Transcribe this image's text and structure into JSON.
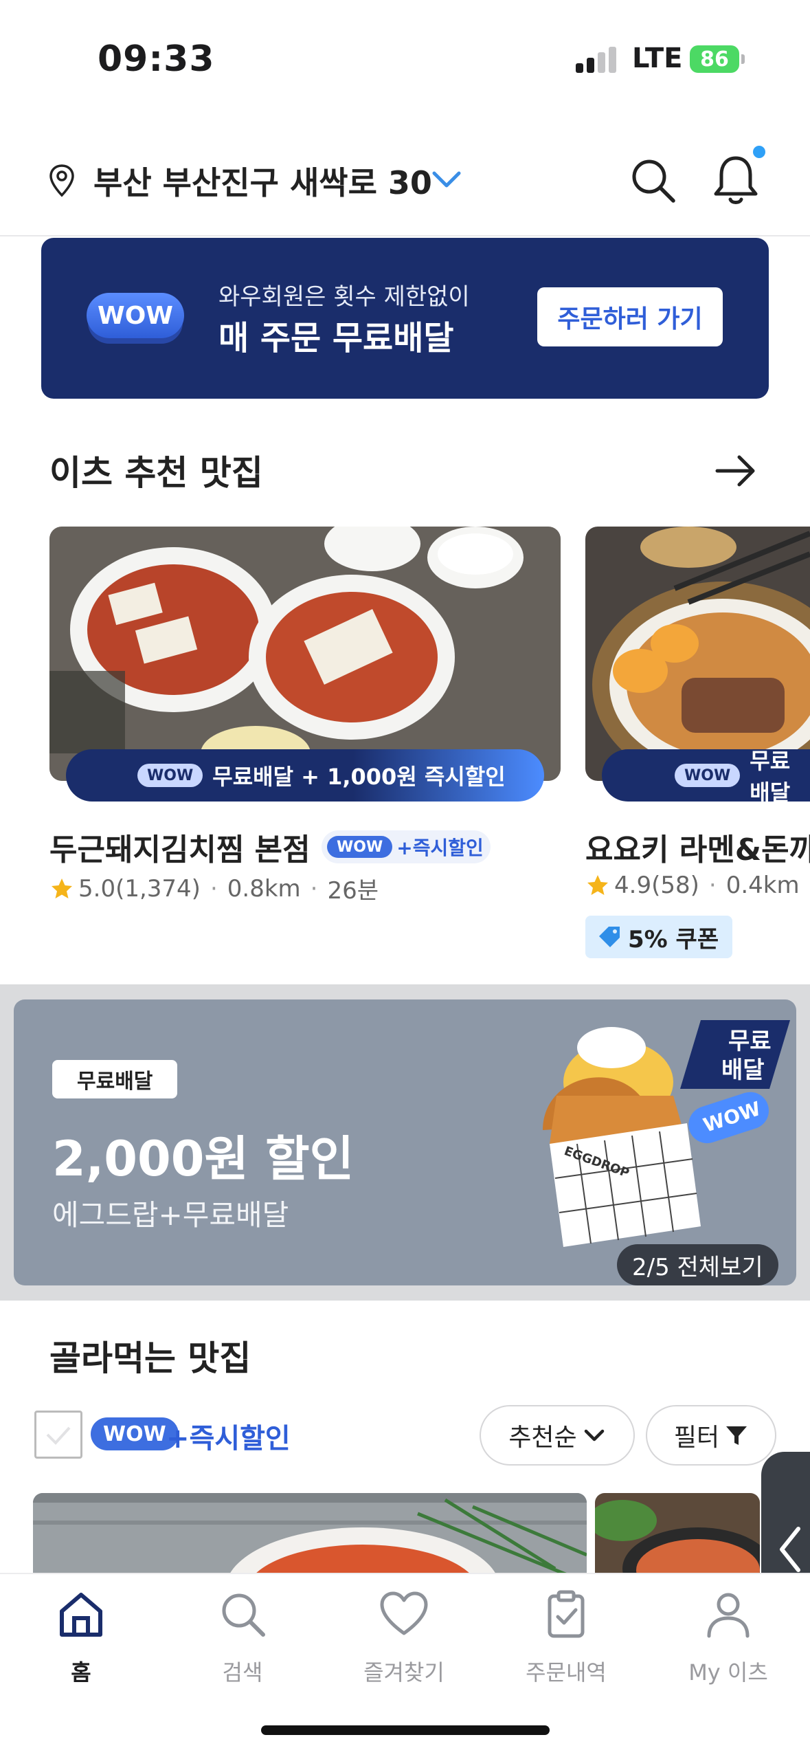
{
  "status_bar": {
    "time": "09:33",
    "network": "LTE",
    "battery": "86"
  },
  "header": {
    "address": "부산 부산진구 새싹로 30"
  },
  "wow_banner": {
    "badge": "WOW",
    "line1": "와우회원은 횟수 제한없이",
    "line2": "매 주문 무료배달",
    "button": "주문하러 가기"
  },
  "recommend": {
    "title": "이츠 추천 맛집",
    "stores": [
      {
        "name": "두근돼지김치찜 본점",
        "promo_badge": "WOW",
        "promo_text": "무료배달 + 1,000원 즉시할인",
        "tag_badge": "WOW",
        "tag_text": "+즉시할인",
        "rating": "5.0",
        "reviews": "(1,374)",
        "distance": "0.8km",
        "time": "26분"
      },
      {
        "name": "요요키 라멘&돈까",
        "promo_badge": "WOW",
        "promo_text": "무료배달",
        "rating": "4.9",
        "reviews": "(58)",
        "distance": "0.4km",
        "coupon": "5% 쿠폰"
      }
    ]
  },
  "promo": {
    "chip": "무료배달",
    "main": "2,000원 할인",
    "sub": "에그드랍+무료배달",
    "image_text": "EGGDROP",
    "free_delivery_tag": "무료\n배달",
    "wow_sticker": "WOW",
    "page_indicator": "2/5 전체보기"
  },
  "pick_section": {
    "title": "골라먹는 맛집",
    "filter_badge": "WOW",
    "filter_label": "+즉시할인",
    "sort_label": "추천순",
    "filter_button": "필터"
  },
  "tabs": [
    {
      "label": "홈",
      "icon": "home-icon",
      "active": true
    },
    {
      "label": "검색",
      "icon": "search-icon"
    },
    {
      "label": "즐겨찾기",
      "icon": "heart-icon"
    },
    {
      "label": "주문내역",
      "icon": "clipboard-icon"
    },
    {
      "label": "My 이츠",
      "icon": "user-icon"
    }
  ],
  "colors": {
    "navy": "#1a2d6b",
    "accent_blue": "#2f5ed8",
    "wow_blue": "#3d6ee0",
    "promo_gray": "#8d98a7"
  }
}
